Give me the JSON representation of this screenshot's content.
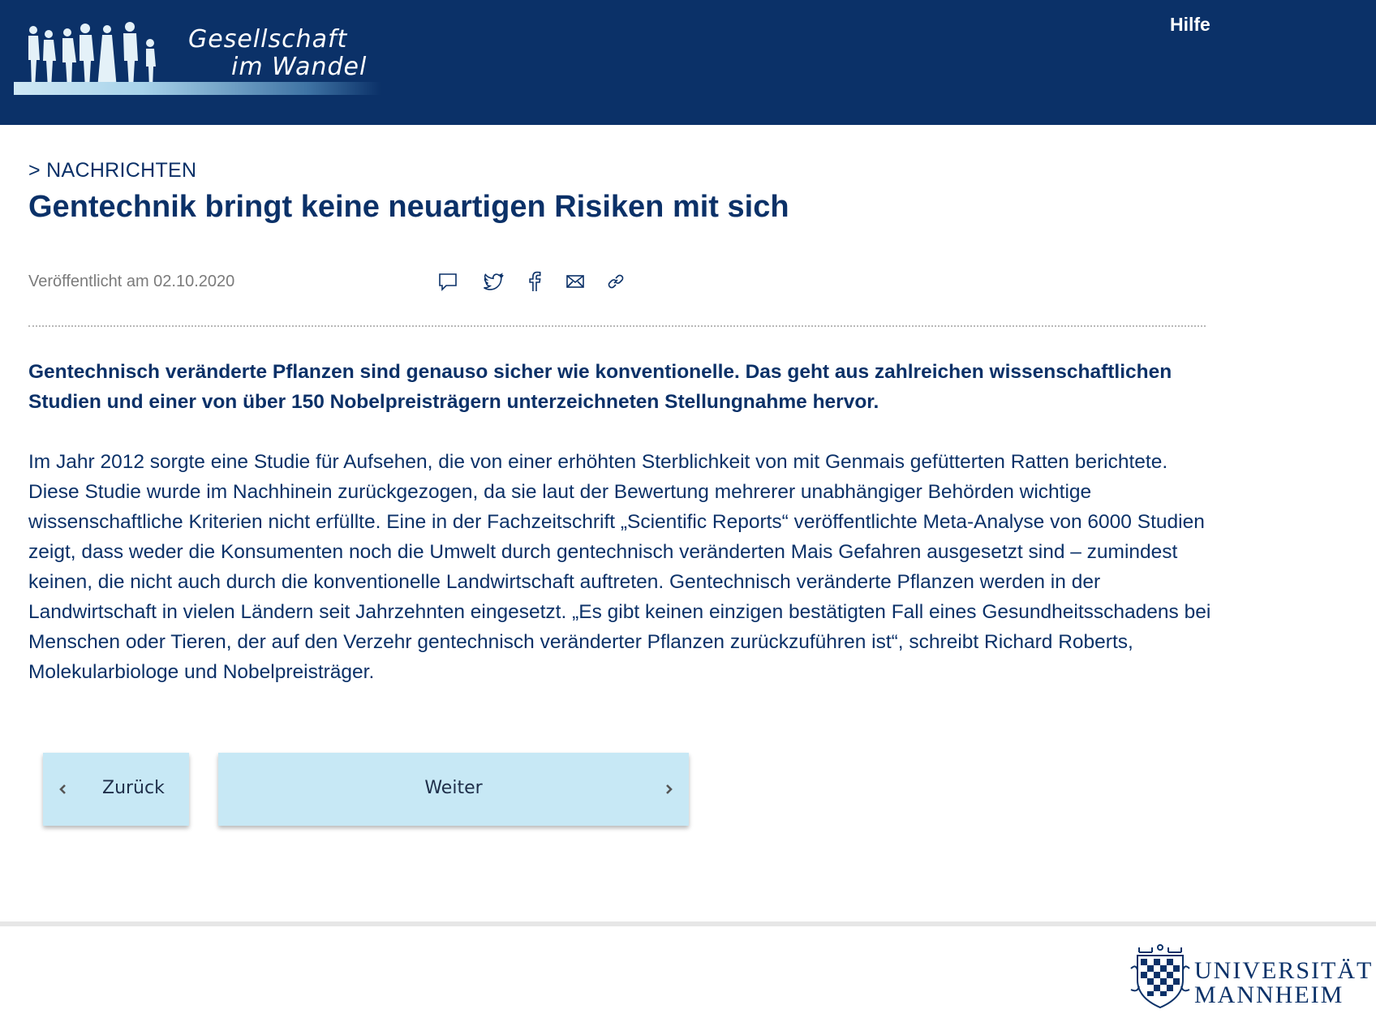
{
  "header": {
    "logo_line1": "Gesellschaft",
    "logo_line2": "im Wandel",
    "help_label": "Hilfe"
  },
  "article": {
    "breadcrumb": "> NACHRICHTEN",
    "title": "Gentechnik bringt keine neuartigen Risiken mit sich",
    "published": "Veröffentlicht am 02.10.2020",
    "share_icons": [
      "comment-icon",
      "twitter-icon",
      "facebook-icon",
      "mail-icon",
      "link-icon"
    ],
    "lead": "Gentechnisch veränderte Pflanzen sind genauso sicher wie konventionelle. Das geht aus zahlreichen wissenschaftlichen Studien und einer von über 150 Nobelpreisträgern unterzeichneten Stellungnahme hervor.",
    "body": "Im Jahr 2012 sorgte eine Studie für Aufsehen, die von einer erhöhten Sterblichkeit von mit Genmais gefütterten Ratten berichtete. Diese Studie wurde im Nachhinein zurückgezogen, da sie laut der Bewertung mehrerer unabhängiger Behörden wichtige wissenschaftliche Kriterien nicht erfüllte. Eine in der Fachzeitschrift „Scientific Reports“ veröffentlichte Meta-Analyse von 6000 Studien zeigt, dass weder die Konsumenten noch die Umwelt durch gentechnisch veränderten Mais Gefahren ausgesetzt sind – zumindest keinen, die nicht auch durch die konventionelle Landwirtschaft auftreten. Gentechnisch veränderte Pflanzen werden in der Landwirtschaft in vielen Ländern seit Jahrzehnten eingesetzt. „Es gibt keinen einzigen bestätigten Fall eines Gesundheitsschadens bei Menschen oder Tieren, der auf den Verzehr gentechnisch veränderter Pflanzen zurückzuführen ist“, schreibt Richard Roberts, Molekularbiologe und Nobelpreisträger."
  },
  "navigation": {
    "back_label": "Zurück",
    "next_label": "Weiter"
  },
  "footer": {
    "university_line1": "UNIVERSITÄT",
    "university_line2": "MANNHEIM"
  },
  "colors": {
    "header_bg": "#0b3168",
    "text_primary": "#0b3168",
    "button_bg": "#c7e8f5",
    "meta_gray": "#7b7b7b"
  }
}
